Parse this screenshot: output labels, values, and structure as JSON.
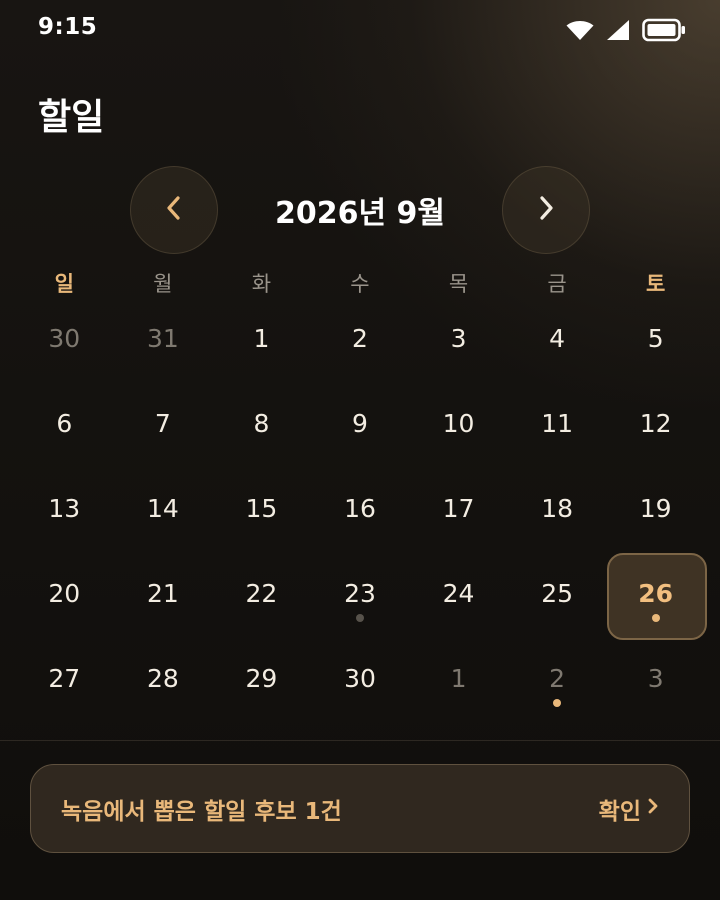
{
  "status_bar": {
    "time": "9:15",
    "icons": [
      "wifi-icon",
      "cellular-signal-icon",
      "battery-icon"
    ]
  },
  "page": {
    "title": "할일"
  },
  "calendar": {
    "month_label": "2026년 9월",
    "prev_icon": "chevron-left-icon",
    "next_icon": "chevron-right-icon",
    "weekdays": [
      "일",
      "월",
      "화",
      "수",
      "목",
      "금",
      "토"
    ],
    "weeks": [
      [
        {
          "n": "30",
          "other": true
        },
        {
          "n": "31",
          "other": true
        },
        {
          "n": "1"
        },
        {
          "n": "2"
        },
        {
          "n": "3"
        },
        {
          "n": "4"
        },
        {
          "n": "5"
        }
      ],
      [
        {
          "n": "6"
        },
        {
          "n": "7"
        },
        {
          "n": "8"
        },
        {
          "n": "9"
        },
        {
          "n": "10"
        },
        {
          "n": "11"
        },
        {
          "n": "12"
        }
      ],
      [
        {
          "n": "13"
        },
        {
          "n": "14"
        },
        {
          "n": "15"
        },
        {
          "n": "16"
        },
        {
          "n": "17"
        },
        {
          "n": "18"
        },
        {
          "n": "19"
        }
      ],
      [
        {
          "n": "20"
        },
        {
          "n": "21"
        },
        {
          "n": "22"
        },
        {
          "n": "23",
          "dot": "muted"
        },
        {
          "n": "24"
        },
        {
          "n": "25"
        },
        {
          "n": "26",
          "selected": true,
          "dot": "accent"
        }
      ],
      [
        {
          "n": "27"
        },
        {
          "n": "28"
        },
        {
          "n": "29"
        },
        {
          "n": "30"
        },
        {
          "n": "1",
          "other": true
        },
        {
          "n": "2",
          "other": true,
          "dot": "accent"
        },
        {
          "n": "3",
          "other": true
        }
      ]
    ]
  },
  "suggestion": {
    "text": "녹음에서 뽑은 할일 후보 1건",
    "action_label": "확인",
    "action_icon": "chevron-right-icon"
  },
  "colors": {
    "accent": "#e9b87a",
    "selected_bg": "#3f3324",
    "text": "#f3ede2",
    "muted": "#7f7970"
  }
}
